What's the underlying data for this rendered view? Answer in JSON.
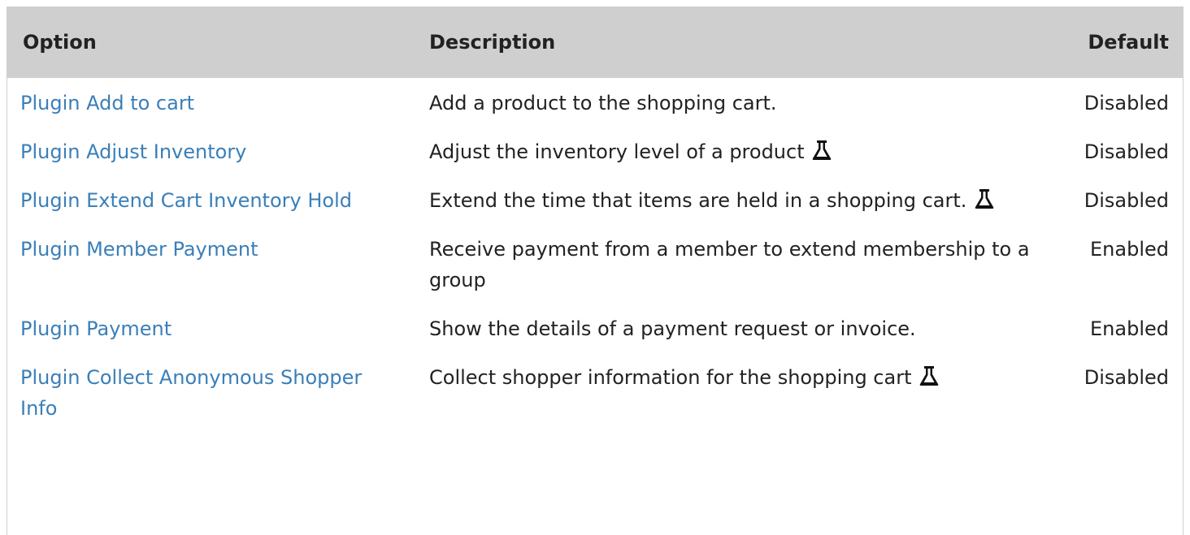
{
  "table": {
    "headers": {
      "option": "Option",
      "description": "Description",
      "default": "Default"
    },
    "rows": [
      {
        "option": "Plugin Add to cart",
        "description": "Add a product to the shopping cart.",
        "experimental": false,
        "default": "Disabled"
      },
      {
        "option": "Plugin Adjust Inventory",
        "description": "Adjust the inventory level of a product",
        "experimental": true,
        "default": "Disabled"
      },
      {
        "option": "Plugin Extend Cart Inventory Hold",
        "description": "Extend the time that items are held in a shopping cart.",
        "experimental": true,
        "default": "Disabled"
      },
      {
        "option": "Plugin Member Payment",
        "description": "Receive payment from a member to extend membership to a group",
        "experimental": false,
        "default": "Enabled"
      },
      {
        "option": "Plugin Payment",
        "description": "Show the details of a payment request or invoice.",
        "experimental": false,
        "default": "Enabled"
      },
      {
        "option": "Plugin Collect Anonymous Shopper Info",
        "description": "Collect shopper information for the shopping cart",
        "experimental": true,
        "default": "Disabled"
      }
    ]
  },
  "icons": {
    "experimental": "flask-icon"
  },
  "colors": {
    "header_bg": "#cfcfcf",
    "link": "#3a7fb8",
    "text": "#222222"
  }
}
